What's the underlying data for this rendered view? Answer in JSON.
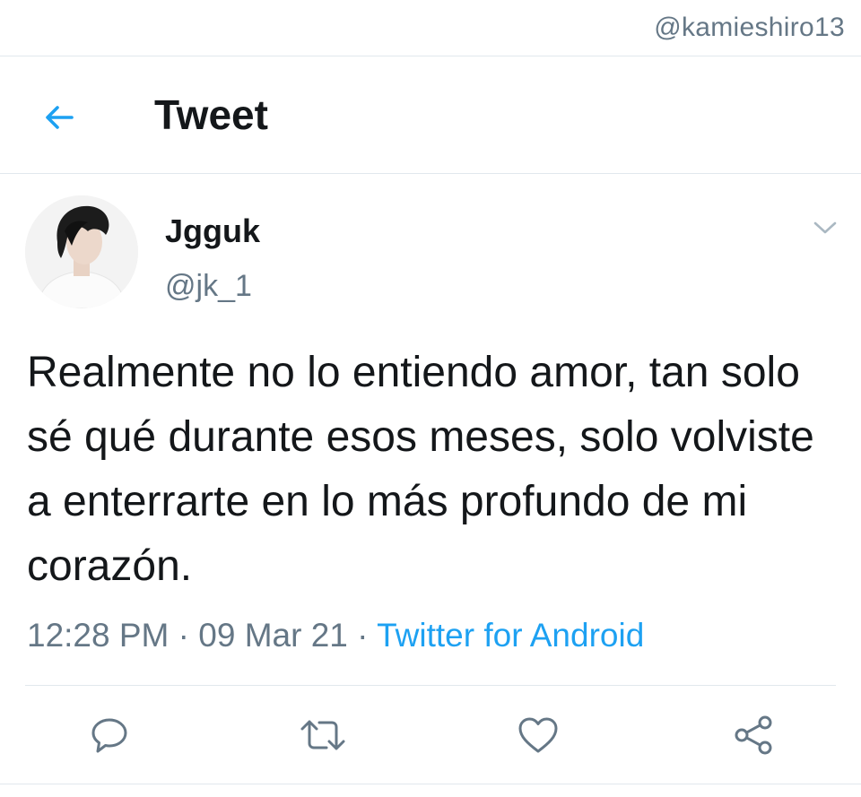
{
  "watermark": "@kamieshiro13",
  "header": {
    "title": "Tweet",
    "back_icon": "arrow-left-icon"
  },
  "tweet": {
    "author": {
      "display_name": "Jgguk",
      "handle": "@jk_1",
      "avatar_icon": "profile-avatar"
    },
    "text": "Realmente no lo entiendo amor, tan solo sé qué durante esos meses, solo volviste a enterrarte en lo más profundo de mi corazón.",
    "time": "12:28 PM",
    "separator": "·",
    "date": "09 Mar 21",
    "source": "Twitter for Android"
  },
  "actions": [
    {
      "name": "reply",
      "icon": "reply-icon"
    },
    {
      "name": "retweet",
      "icon": "retweet-icon"
    },
    {
      "name": "like",
      "icon": "heart-icon"
    },
    {
      "name": "share",
      "icon": "share-icon"
    }
  ],
  "colors": {
    "accent": "#1da1f2",
    "text": "#14171a",
    "secondary": "#657786",
    "divider": "#e1e8ed",
    "icon_gray": "#657786"
  }
}
